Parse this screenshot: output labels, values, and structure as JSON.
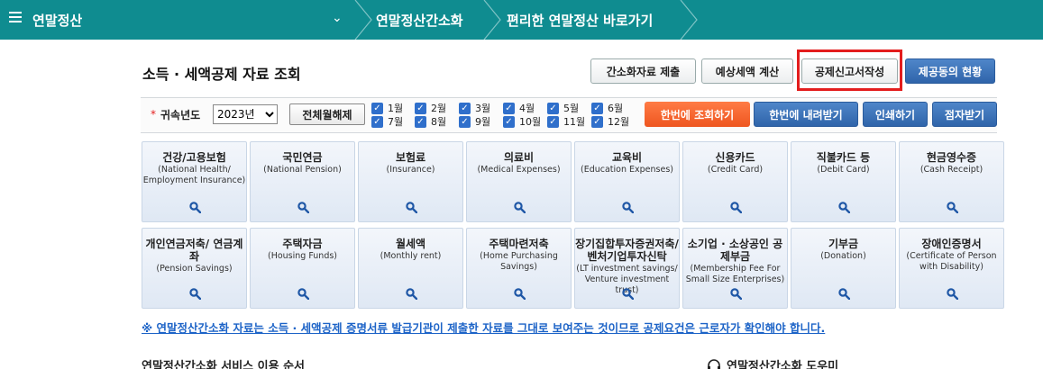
{
  "topbar": {
    "home_title": "연말정산",
    "breadcrumb": [
      "연말정산간소화",
      "편리한 연말정산 바로가기"
    ]
  },
  "section": {
    "title": "소득 · 세액공제 자료 조회",
    "buttons": {
      "submit": "간소화자료 제출",
      "estimate": "예상세액 계산",
      "deduction_form": "공제신고서작성",
      "provider_status": "제공동의 현황"
    }
  },
  "filter": {
    "year_label": "귀속년도",
    "year_value": "2023년",
    "uncheck_all": "전체월해제",
    "months": [
      "1월",
      "2월",
      "3월",
      "4월",
      "5월",
      "6월",
      "7월",
      "8월",
      "9월",
      "10월",
      "11월",
      "12월"
    ],
    "query_all": "한번에 조회하기",
    "download_all": "한번에 내려받기",
    "print": "인쇄하기",
    "braille": "점자받기"
  },
  "categories": [
    {
      "kor": "건강/고용보험",
      "eng": "(National Health/ Employment Insurance)"
    },
    {
      "kor": "국민연금",
      "eng": "(National Pension)"
    },
    {
      "kor": "보험료",
      "eng": "(Insurance)"
    },
    {
      "kor": "의료비",
      "eng": "(Medical Expenses)"
    },
    {
      "kor": "교육비",
      "eng": "(Education Expenses)"
    },
    {
      "kor": "신용카드",
      "eng": "(Credit Card)"
    },
    {
      "kor": "직불카드 등",
      "eng": "(Debit Card)"
    },
    {
      "kor": "현금영수증",
      "eng": "(Cash Receipt)"
    },
    {
      "kor": "개인연금저축/ 연금계좌",
      "eng": "(Pension Savings)"
    },
    {
      "kor": "주택자금",
      "eng": "(Housing Funds)"
    },
    {
      "kor": "월세액",
      "eng": "(Monthly rent)"
    },
    {
      "kor": "주택마련저축",
      "eng": "(Home Purchasing Savings)"
    },
    {
      "kor": "장기집합투자증권저축/ 벤처기업투자신탁",
      "eng": "(LT investment savings/ Venture investment trust)"
    },
    {
      "kor": "소기업 · 소상공인 공제부금",
      "eng": "(Membership Fee For Small Size Enterprises)"
    },
    {
      "kor": "기부금",
      "eng": "(Donation)"
    },
    {
      "kor": "장애인증명서",
      "eng": "(Certificate of Person with Disability)"
    }
  ],
  "notice": "※ 연말정산간소화 자료는 소득 · 세액공제 증명서류 발급기관이 제출한 자료를 그대로 보여주는 것이므로 공제요건은 근로자가 확인해야 합니다.",
  "footer": {
    "left": "연말정산간소화 서비스 이용 순서",
    "right": "연말정산간소화 도우미"
  },
  "colors": {
    "topbar": "#0f8c90",
    "highlight": "#e31d1d",
    "primary_blue": "#2f64aa",
    "orange": "#ee5620"
  }
}
